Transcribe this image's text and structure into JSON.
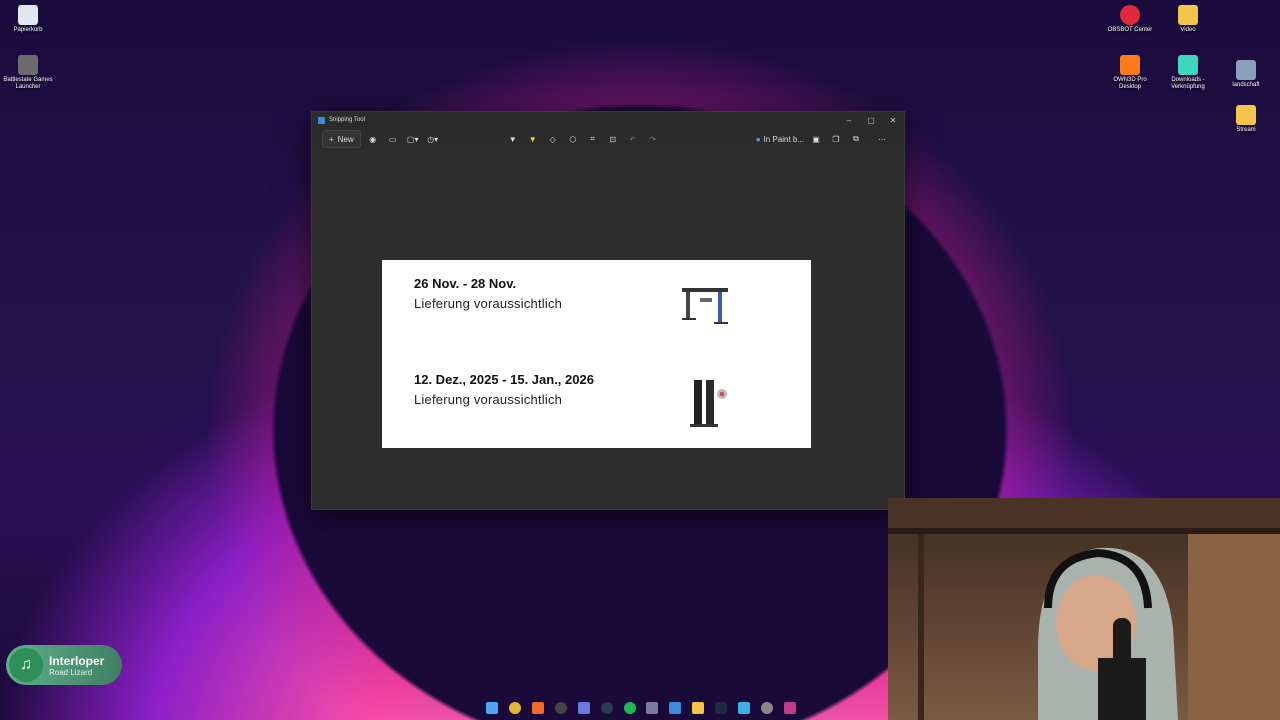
{
  "desktop": {
    "icons": [
      {
        "label": "Papierkorb",
        "icon": "recycle-bin-icon",
        "color": "#dfe8f3"
      },
      {
        "label": "Battlestate Games Launcher",
        "icon": "battlestate-icon",
        "color": "#6b6b6b"
      },
      {
        "label": "OBSBOT Center",
        "icon": "obsbot-icon",
        "color": "#e02a3a"
      },
      {
        "label": "Video",
        "icon": "folder-icon",
        "color": "#f3c64a"
      },
      {
        "label": "OWN3D Pro Desktop",
        "icon": "own3d-icon",
        "color": "#ff7a1a"
      },
      {
        "label": "Downloads - Verknüpfung",
        "icon": "folder-shortcut-icon",
        "color": "#3fd6c0"
      },
      {
        "label": "landschaft",
        "icon": "image-file-icon",
        "color": "#8aa0b8"
      },
      {
        "label": "Stream",
        "icon": "folder-icon",
        "color": "#f3c64a"
      }
    ]
  },
  "snipping_tool": {
    "title": "Snipping Tool",
    "new_label": "New",
    "paint_label": "In Paint b...",
    "window_controls": {
      "minimize": "–",
      "maximize": "▢",
      "close": "✕"
    }
  },
  "snip": {
    "entries": [
      {
        "date": "26 Nov. - 28 Nov.",
        "sub": "Lieferung voraussichtlich",
        "product_icon": "desk-frame-icon"
      },
      {
        "date": "12. Dez., 2025 - 15. Jan., 2026",
        "sub": "Lieferung voraussichtlich",
        "product_icon": "desk-legs-icon"
      }
    ]
  },
  "music_widget": {
    "title": "Interloper",
    "artist": "Road Lizard",
    "icon": "music-note-icon"
  },
  "accent": "#ff4fa6"
}
